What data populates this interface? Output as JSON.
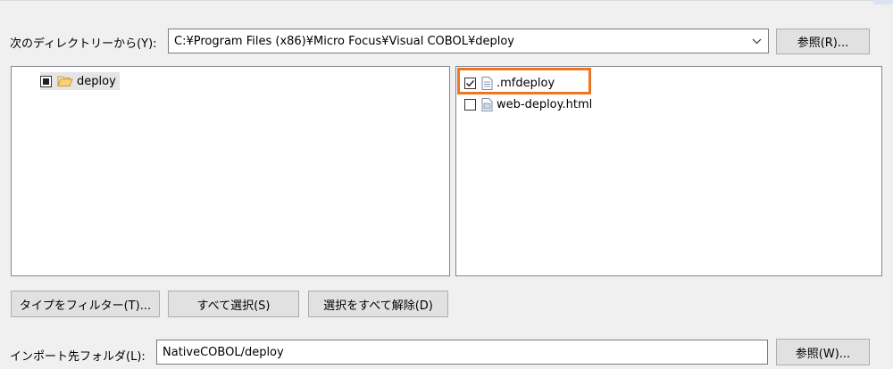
{
  "from_directory": {
    "label": "次のディレクトリーから(Y):",
    "value": "C:¥Program Files (x86)¥Micro Focus¥Visual COBOL¥deploy",
    "browse_label": "参照(R)..."
  },
  "folder_tree": {
    "items": [
      {
        "label": "deploy",
        "state": "partial",
        "icon": "folder-open-icon"
      }
    ]
  },
  "file_list": {
    "items": [
      {
        "label": ".mfdeploy",
        "checked": true,
        "icon": "file-text-icon"
      },
      {
        "label": "web-deploy.html",
        "checked": false,
        "icon": "file-html-icon"
      }
    ]
  },
  "buttons": {
    "filter_types": "タイプをフィルター(T)...",
    "select_all": "すべて選択(S)",
    "deselect_all": "選択をすべて解除(D)"
  },
  "into_folder": {
    "label": "インポート先フォルダ(L):",
    "value": "NativeCOBOL/deploy",
    "browse_label": "参照(W)..."
  },
  "colors": {
    "highlight": "#ee7623",
    "folder": "#e8b24a"
  }
}
